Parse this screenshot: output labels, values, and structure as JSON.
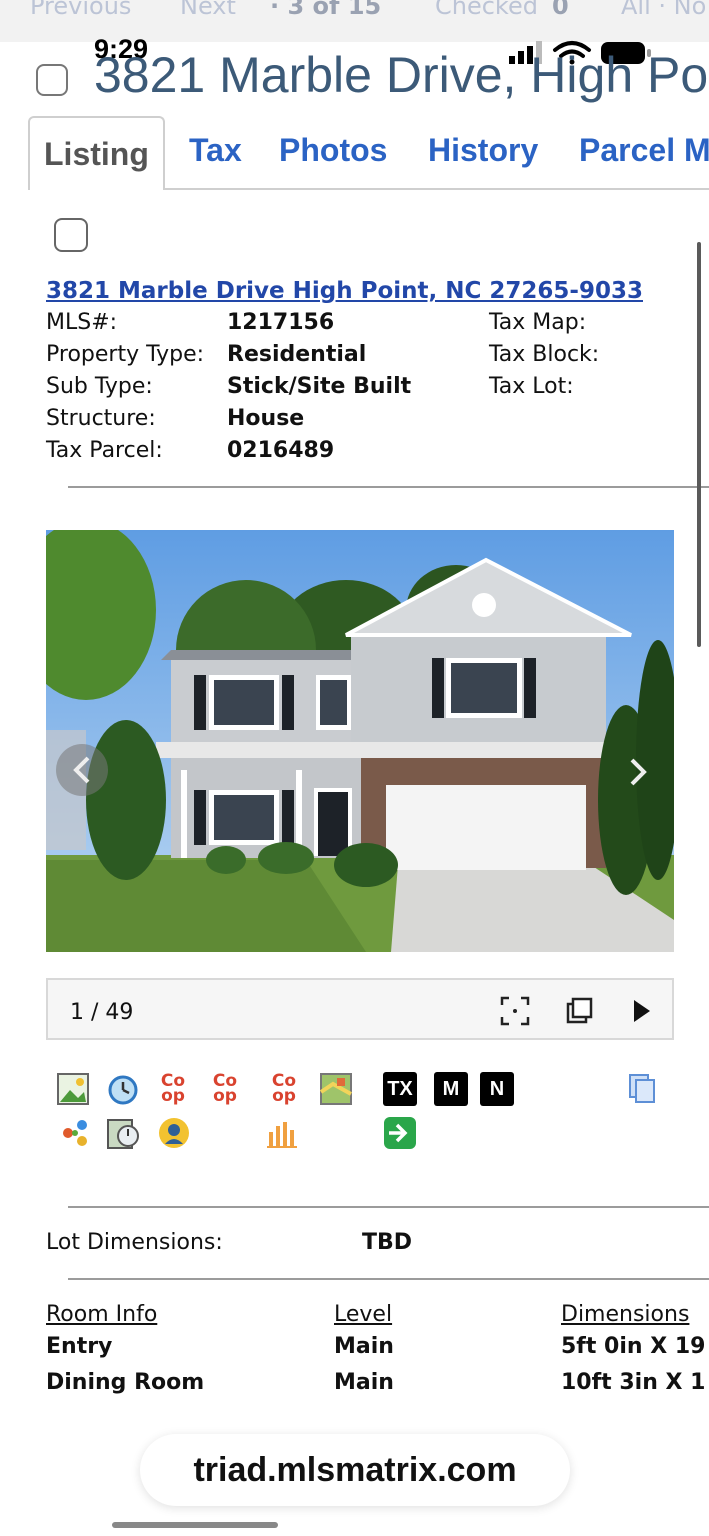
{
  "topnav": {
    "previous": "Previous",
    "next": "Next",
    "position_prefix": "· 3 of 15",
    "checked_label": "Checked",
    "checked_count": "0",
    "all_label": "All · No"
  },
  "status": {
    "time": "9:29"
  },
  "title": "3821 Marble Drive, High Po",
  "tabs": [
    {
      "label": "Listing",
      "active": true
    },
    {
      "label": "Tax"
    },
    {
      "label": "Photos"
    },
    {
      "label": "History"
    },
    {
      "label": "Parcel M"
    }
  ],
  "listing": {
    "address_link": "3821 Marble Drive High Point, NC 27265-9033",
    "fields_left": [
      {
        "label": "MLS#:",
        "value": "1217156"
      },
      {
        "label": "Property Type:",
        "value": "Residential"
      },
      {
        "label": "Sub Type:",
        "value": "Stick/Site Built"
      },
      {
        "label": "Structure:",
        "value": "House"
      },
      {
        "label": "Tax Parcel:",
        "value": "0216489"
      }
    ],
    "fields_right": [
      {
        "label": "Tax Map:"
      },
      {
        "label": "Tax Block:"
      },
      {
        "label": "Tax Lot:"
      }
    ]
  },
  "gallery": {
    "counter": "1 / 49"
  },
  "icons": {
    "coop_text_line1": "Co",
    "coop_text_line2": "op",
    "tx": "TX",
    "m": "M",
    "n": "N"
  },
  "lot": {
    "label": "Lot Dimensions:",
    "value": "TBD"
  },
  "rooms": {
    "headers": [
      "Room Info",
      "Level",
      "Dimensions"
    ],
    "rows": [
      {
        "room": "Entry",
        "level": "Main",
        "dims": "5ft 0in X 19"
      },
      {
        "room": "Dining Room",
        "level": "Main",
        "dims": "10ft 3in X 1"
      }
    ]
  },
  "browser": {
    "url": "triad.mlsmatrix.com"
  },
  "colors": {
    "link": "#2b63c4",
    "title": "#3c5a78",
    "coop": "#d9432f"
  }
}
